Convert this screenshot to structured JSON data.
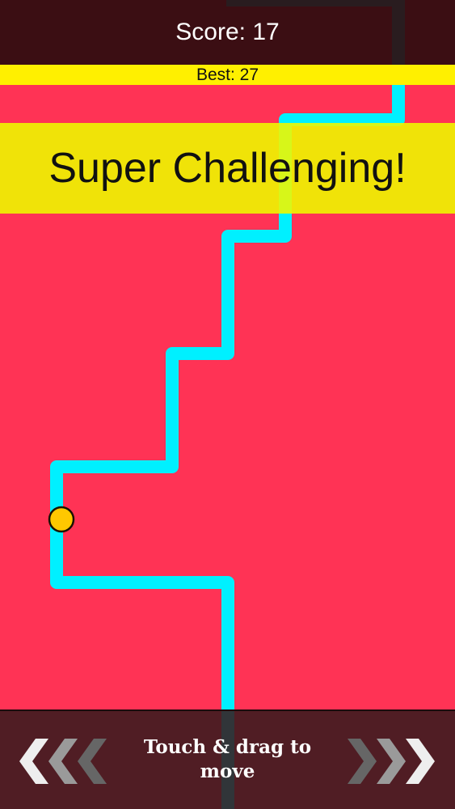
{
  "hud": {
    "score_text": "Score: 17",
    "best_text": "Best: 27"
  },
  "banner": {
    "text": "Super Challenging!"
  },
  "controls": {
    "hint_line1": "Touch & drag to",
    "hint_line2": "move"
  },
  "icons": {
    "left": "chevrons-left-icon",
    "right": "chevrons-right-icon",
    "player": "ball-icon"
  },
  "colors": {
    "background": "#ff3355",
    "path": "#00f0ff",
    "player": "#ffc800",
    "best_bar": "#fff000",
    "banner": "#eef600"
  }
}
